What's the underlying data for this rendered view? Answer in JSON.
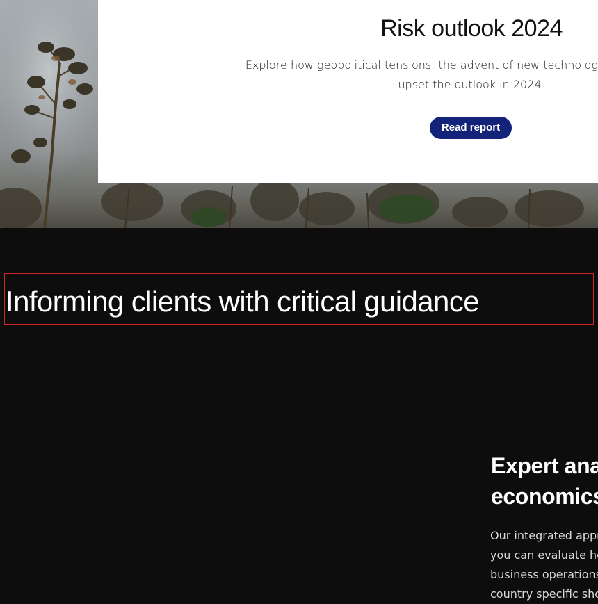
{
  "hero": {
    "image": "smoky-forest-background"
  },
  "card": {
    "title": "Risk outlook 2024",
    "description_line1": "Explore how geopolitical tensions, the advent of new technologies and persistent",
    "description_line2": "upset the outlook in 2024.",
    "button_label": "Read report",
    "button_color": "#14237a"
  },
  "section": {
    "heading": "Informing clients with critical guidance",
    "highlight_border_color": "#d12626"
  },
  "expert": {
    "title_line1": "Expert ana",
    "title_line2": "economics",
    "body_lines": [
      "Our integrated appro",
      "you can evaluate how",
      "business operations c",
      "country specific shoc"
    ]
  },
  "colors": {
    "page_background": "#0d0d0d",
    "card_background": "#ffffff"
  }
}
